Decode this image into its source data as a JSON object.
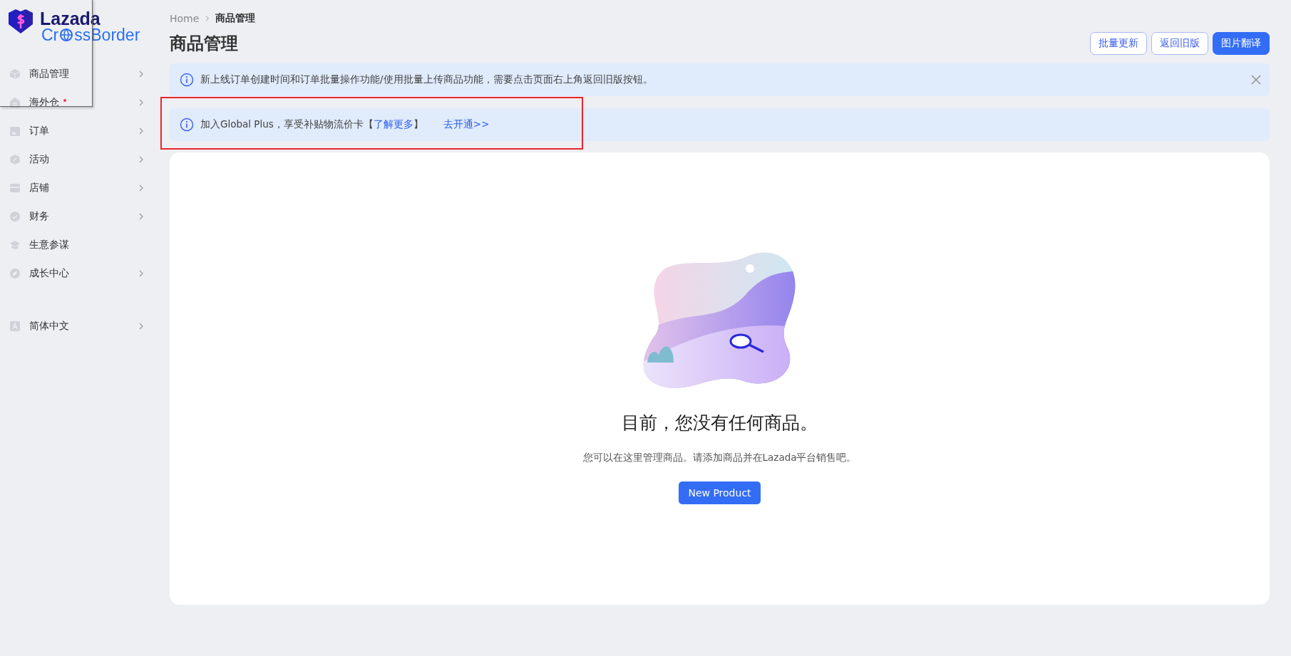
{
  "logo": {
    "brand": "Lazada",
    "product_start": "Cr",
    "product_end": "ssBorder"
  },
  "sidebar": {
    "items": [
      {
        "label": "商品管理",
        "has_submenu": true,
        "dot": false
      },
      {
        "label": "海外仓",
        "has_submenu": true,
        "dot": true
      },
      {
        "label": "订单",
        "has_submenu": true,
        "dot": false
      },
      {
        "label": "活动",
        "has_submenu": true,
        "dot": false
      },
      {
        "label": "店铺",
        "has_submenu": true,
        "dot": false
      },
      {
        "label": "财务",
        "has_submenu": true,
        "dot": false
      },
      {
        "label": "生意参谋",
        "has_submenu": false,
        "dot": false
      },
      {
        "label": "成长中心",
        "has_submenu": true,
        "dot": false
      }
    ],
    "language": {
      "label": "简体中文",
      "has_submenu": true
    }
  },
  "breadcrumb": [
    "Home",
    "商品管理"
  ],
  "title": "商品管理",
  "header_buttons": [
    {
      "label": "批量更新",
      "kind": "outline"
    },
    {
      "label": "返回旧版",
      "kind": "outline"
    },
    {
      "label": "图片翻译",
      "kind": "primary"
    }
  ],
  "notices": [
    {
      "text": "新上线订单创建时间和订单批量操作功能/使用批量上传商品功能，需要点击页面右上角返回旧版按钮。",
      "dismissible": true,
      "highlighted": false
    },
    {
      "text": "加入Global Plus，享受补贴物流价卡【",
      "link": "了解更多",
      "text_after": "】",
      "action": "去开通>>",
      "dismissible": false,
      "highlighted": true
    }
  ],
  "empty_state": {
    "heading": "目前，您没有任何商品。",
    "description": "您可以在这里管理商品。请添加商品并在Lazada平台销售吧。",
    "button": "New Product"
  }
}
